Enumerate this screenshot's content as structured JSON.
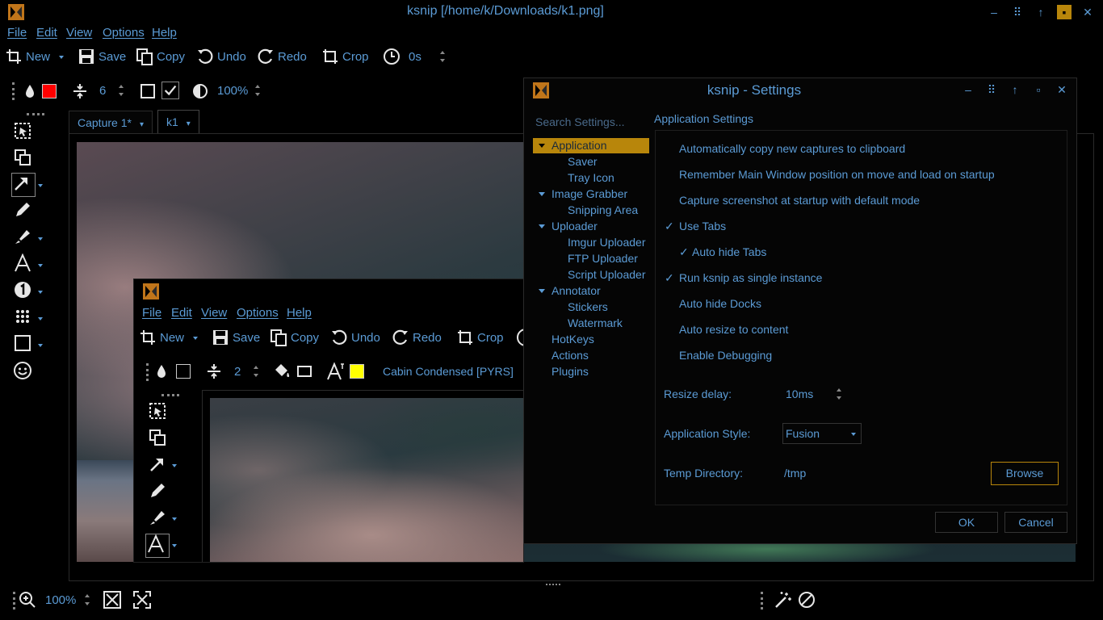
{
  "window": {
    "title": "ksnip [/home/k/Downloads/k1.png]"
  },
  "menu": [
    "File",
    "Edit",
    "View",
    "Options",
    "Help"
  ],
  "toolbar": {
    "new": "New",
    "save": "Save",
    "copy": "Copy",
    "undo": "Undo",
    "redo": "Redo",
    "crop": "Crop",
    "delay": "0s"
  },
  "annotator_bar": {
    "color": "#ff0000",
    "width": "6",
    "opacity": "100%"
  },
  "tabs": [
    {
      "label": "Capture 1*"
    },
    {
      "label": "k1"
    }
  ],
  "statusbar": {
    "zoom": "100%"
  },
  "inner": {
    "menu": [
      "File",
      "Edit",
      "View",
      "Options",
      "Help"
    ],
    "toolbar": {
      "new": "New",
      "save": "Save",
      "copy": "Copy",
      "undo": "Undo",
      "redo": "Redo",
      "crop": "Crop"
    },
    "width": "2",
    "font": "Cabin Condensed [PYRS]",
    "color": "#ffff00"
  },
  "settings": {
    "title": "ksnip - Settings",
    "search_placeholder": "Search Settings...",
    "tree": {
      "application": "Application",
      "saver": "Saver",
      "tray_icon": "Tray Icon",
      "image_grabber": "Image Grabber",
      "snipping_area": "Snipping Area",
      "uploader": "Uploader",
      "imgur_uploader": "Imgur Uploader",
      "ftp_uploader": "FTP Uploader",
      "script_uploader": "Script Uploader",
      "annotator": "Annotator",
      "stickers": "Stickers",
      "watermark": "Watermark",
      "hotkeys": "HotKeys",
      "actions": "Actions",
      "plugins": "Plugins"
    },
    "section_title": "Application Settings",
    "options": [
      {
        "label": "Automatically copy new captures to clipboard",
        "checked": false
      },
      {
        "label": "Remember Main Window position on move and load on startup",
        "checked": false
      },
      {
        "label": "Capture screenshot at startup with default mode",
        "checked": false
      },
      {
        "label": "Use Tabs",
        "checked": true
      },
      {
        "label": "Auto hide Tabs",
        "checked": true
      },
      {
        "label": "Run ksnip as single instance",
        "checked": true
      },
      {
        "label": "Auto hide Docks",
        "checked": false
      },
      {
        "label": "Auto resize to content",
        "checked": false
      },
      {
        "label": "Enable Debugging",
        "checked": false
      }
    ],
    "check_mark": "✓",
    "resize_delay_label": "Resize delay:",
    "resize_delay_value": "10ms",
    "style_label": "Application Style:",
    "style_value": "Fusion",
    "temp_dir_label": "Temp Directory:",
    "temp_dir_value": "/tmp",
    "browse": "Browse",
    "ok": "OK",
    "cancel": "Cancel"
  },
  "colors": {
    "accent_text": "#5b9bd5",
    "selection": "#b8860b",
    "browse_border": "#b8860b"
  }
}
